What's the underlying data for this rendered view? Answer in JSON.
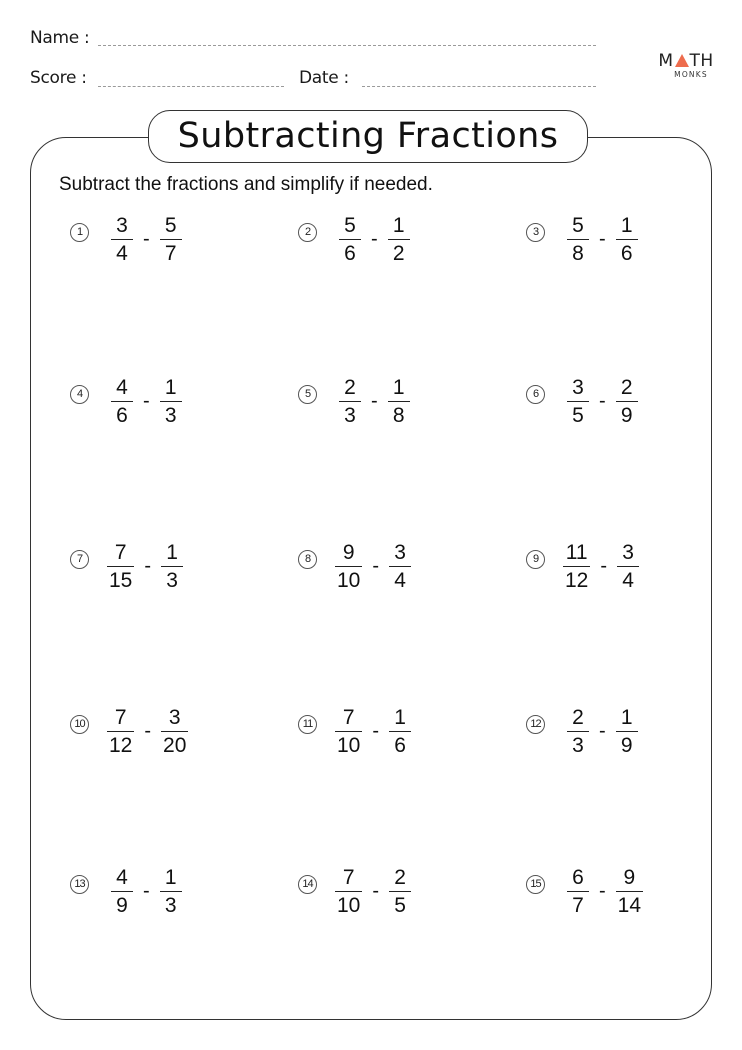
{
  "header": {
    "name_label": "Name :",
    "score_label": "Score :",
    "date_label": "Date :"
  },
  "logo": {
    "top_left": "M",
    "top_right": "TH",
    "bottom": "MONKS",
    "accent_color": "#ee6c4d"
  },
  "title": "Subtracting Fractions",
  "instructions": "Subtract the fractions and simplify if needed.",
  "operator": "-",
  "problems": [
    {
      "number": "1",
      "a_num": "3",
      "a_den": "4",
      "b_num": "5",
      "b_den": "7"
    },
    {
      "number": "2",
      "a_num": "5",
      "a_den": "6",
      "b_num": "1",
      "b_den": "2"
    },
    {
      "number": "3",
      "a_num": "5",
      "a_den": "8",
      "b_num": "1",
      "b_den": "6"
    },
    {
      "number": "4",
      "a_num": "4",
      "a_den": "6",
      "b_num": "1",
      "b_den": "3"
    },
    {
      "number": "5",
      "a_num": "2",
      "a_den": "3",
      "b_num": "1",
      "b_den": "8"
    },
    {
      "number": "6",
      "a_num": "3",
      "a_den": "5",
      "b_num": "2",
      "b_den": "9"
    },
    {
      "number": "7",
      "a_num": "7",
      "a_den": "15",
      "b_num": "1",
      "b_den": "3"
    },
    {
      "number": "8",
      "a_num": "9",
      "a_den": "10",
      "b_num": "3",
      "b_den": "4"
    },
    {
      "number": "9",
      "a_num": "11",
      "a_den": "12",
      "b_num": "3",
      "b_den": "4"
    },
    {
      "number": "10",
      "a_num": "7",
      "a_den": "12",
      "b_num": "3",
      "b_den": "20"
    },
    {
      "number": "11",
      "a_num": "7",
      "a_den": "10",
      "b_num": "1",
      "b_den": "6"
    },
    {
      "number": "12",
      "a_num": "2",
      "a_den": "3",
      "b_num": "1",
      "b_den": "9"
    },
    {
      "number": "13",
      "a_num": "4",
      "a_den": "9",
      "b_num": "1",
      "b_den": "3"
    },
    {
      "number": "14",
      "a_num": "7",
      "a_den": "10",
      "b_num": "2",
      "b_den": "5"
    },
    {
      "number": "15",
      "a_num": "6",
      "a_den": "7",
      "b_num": "9",
      "b_den": "14"
    }
  ]
}
